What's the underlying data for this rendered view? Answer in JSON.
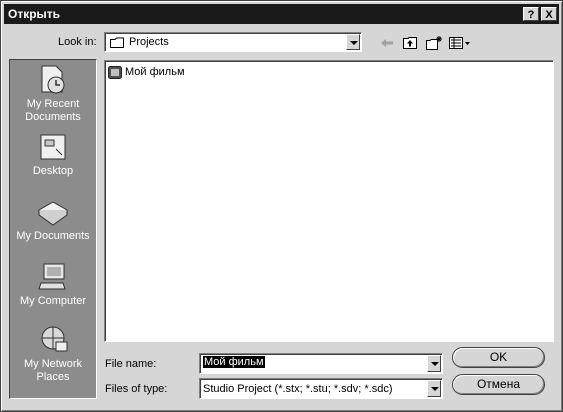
{
  "window": {
    "title": "Открыть",
    "help_label": "?",
    "close_label": "X"
  },
  "lookin": {
    "label": "Look in:",
    "value": "Projects"
  },
  "toolbar": {
    "icons": [
      "back-arrow-icon",
      "up-folder-icon",
      "new-folder-icon",
      "view-menu-icon"
    ]
  },
  "places": [
    {
      "label": "My Recent Documents",
      "icon": "recent-documents-icon"
    },
    {
      "label": "Desktop",
      "icon": "desktop-icon"
    },
    {
      "label": "My Documents",
      "icon": "my-documents-icon"
    },
    {
      "label": "My Computer",
      "icon": "my-computer-icon"
    },
    {
      "label": "My Network Places",
      "icon": "network-places-icon"
    }
  ],
  "files": [
    {
      "name": "Мой фильм",
      "icon": "film-project-icon"
    }
  ],
  "filename": {
    "label": "File name:",
    "value": "Мой фильм"
  },
  "filetype": {
    "label": "Files of type:",
    "value": "Studio Project (*.stx; *.stu; *.sdv; *.sdc)"
  },
  "buttons": {
    "ok": "OK",
    "cancel": "Отмена"
  }
}
